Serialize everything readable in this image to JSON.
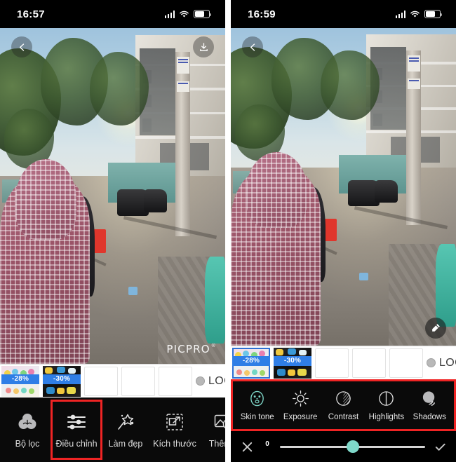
{
  "left_phone": {
    "status_bar": {
      "clock": "16:57",
      "signal_icon": "cellular-signal-icon",
      "wifi_icon": "wifi-icon",
      "battery_icon": "battery-icon"
    },
    "photo": {
      "back_icon": "back-chevron-icon",
      "save_icon": "download-save-icon",
      "watermark": "PICPRO",
      "watermark_mark": "®"
    },
    "ad_strip": {
      "items": [
        {
          "badge": "-28%",
          "selected": false
        },
        {
          "badge": "-30%",
          "selected": false
        },
        {
          "badge": "",
          "selected": false
        },
        {
          "badge": "",
          "selected": false
        },
        {
          "badge": "",
          "selected": false
        }
      ],
      "logo_text": "LOGO",
      "logo_icon": "logo-circle-icon"
    },
    "toolbar": {
      "items": [
        {
          "label": "Bộ lọc",
          "icon": "filter-circles-icon",
          "highlighted": false
        },
        {
          "label": "Điều chỉnh",
          "icon": "adjust-sliders-icon",
          "highlighted": true
        },
        {
          "label": "Làm đẹp",
          "icon": "magic-wand-icon",
          "highlighted": false
        },
        {
          "label": "Kích thước",
          "icon": "resize-icon",
          "highlighted": false
        },
        {
          "label": "Thêm ả",
          "icon": "add-photo-icon",
          "highlighted": false
        }
      ]
    }
  },
  "right_phone": {
    "status_bar": {
      "clock": "16:59",
      "signal_icon": "cellular-signal-icon",
      "wifi_icon": "wifi-icon",
      "battery_icon": "battery-icon"
    },
    "photo": {
      "back_icon": "back-chevron-icon",
      "edit_fab_icon": "eraser-brush-icon"
    },
    "ad_strip": {
      "items": [
        {
          "badge": "-28%",
          "selected": true
        },
        {
          "badge": "-30%",
          "selected": false
        },
        {
          "badge": "",
          "selected": false
        },
        {
          "badge": "",
          "selected": false
        },
        {
          "badge": "",
          "selected": false
        }
      ],
      "logo_text": "LOGO",
      "logo_icon": "logo-circle-icon"
    },
    "adjust_bar": {
      "highlighted": true,
      "items": [
        {
          "label": "Skin tone",
          "icon": "face-skin-tone-icon",
          "active": true
        },
        {
          "label": "Exposure",
          "icon": "sun-exposure-icon",
          "active": false
        },
        {
          "label": "Contrast",
          "icon": "contrast-circle-icon",
          "active": false
        },
        {
          "label": "Highlights",
          "icon": "highlights-circle-icon",
          "active": false
        },
        {
          "label": "Shadows",
          "icon": "shadows-sphere-icon",
          "active": false
        }
      ]
    },
    "slider": {
      "value": "0",
      "position_percent": 50,
      "cancel_icon": "close-x-icon",
      "confirm_icon": "check-icon",
      "thumb_color": "#7fd8c9"
    }
  },
  "accent_colors": {
    "highlight_box": "#ef2424",
    "slider_thumb": "#7fd8c9",
    "badge_blue": "#2f7ee6",
    "selection_blue": "#2d6fd4"
  }
}
